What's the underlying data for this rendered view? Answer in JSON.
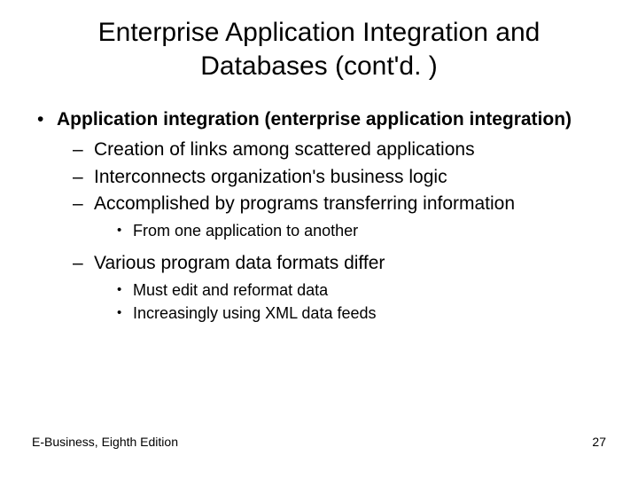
{
  "title": "Enterprise Application Integration and Databases (cont'd. )",
  "b1": "Application integration (enterprise application integration)",
  "b1_1": "Creation of links among scattered applications",
  "b1_2": "Interconnects organization's business logic",
  "b1_3": "Accomplished by programs transferring information",
  "b1_3_1": "From one application to another",
  "b1_4": "Various program data formats differ",
  "b1_4_1": "Must edit and reformat data",
  "b1_4_2": "Increasingly using XML data feeds",
  "footer_left": "E-Business, Eighth Edition",
  "footer_right": "27"
}
